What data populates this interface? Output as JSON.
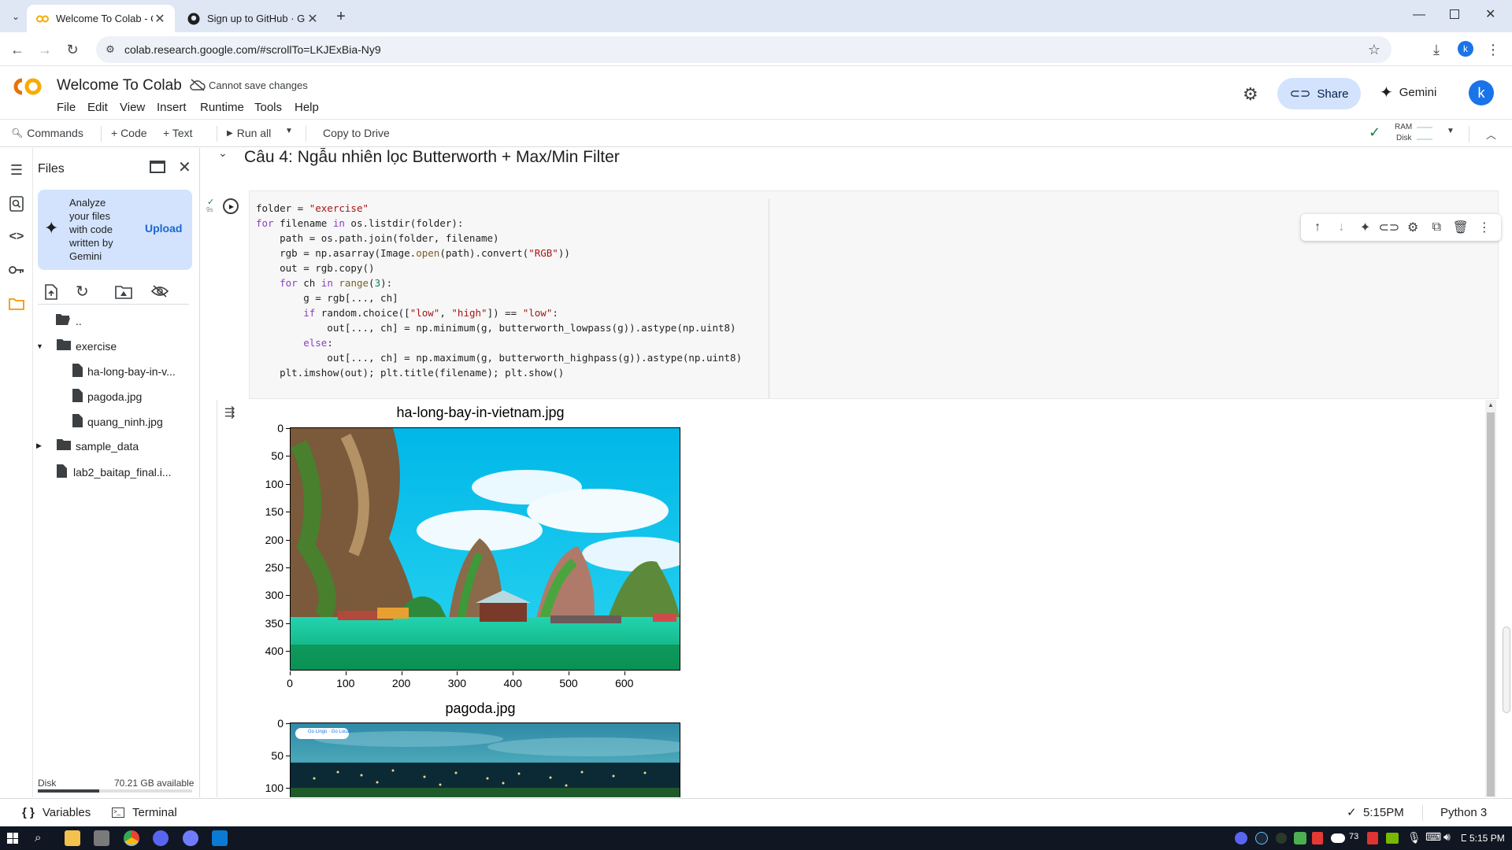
{
  "browser": {
    "tabs": [
      {
        "title": "Welcome To Colab - Colab",
        "active": true
      },
      {
        "title": "Sign up to GitHub · GitHub",
        "active": false
      }
    ],
    "url": "colab.research.google.com/#scrollTo=LKJExBia-Ny9",
    "profile_initial": "k"
  },
  "colab": {
    "notebook_title": "Welcome To Colab",
    "save_status": "Cannot save changes",
    "menu": [
      "File",
      "Edit",
      "View",
      "Insert",
      "Runtime",
      "Tools",
      "Help"
    ],
    "share_label": "Share",
    "gemini_label": "Gemini",
    "avatar_initial": "k",
    "toolbar": {
      "commands": "Commands",
      "code": "+ Code",
      "text": "+ Text",
      "run_all": "Run all",
      "copy_to_drive": "Copy to Drive",
      "ram": "RAM",
      "disk": "Disk"
    }
  },
  "files_panel": {
    "title": "Files",
    "promo_text": "Analyze your files with code written by Gemini",
    "upload_label": "Upload",
    "tree": [
      {
        "name": "..",
        "type": "folder"
      },
      {
        "name": "exercise",
        "type": "folder",
        "expanded": true
      },
      {
        "name": "ha-long-bay-in-v...",
        "type": "file"
      },
      {
        "name": "pagoda.jpg",
        "type": "file"
      },
      {
        "name": "quang_ninh.jpg",
        "type": "file"
      },
      {
        "name": "sample_data",
        "type": "folder"
      },
      {
        "name": "lab2_baitap_final.i...",
        "type": "file"
      }
    ],
    "disk_label": "Disk",
    "disk_available": "70.21 GB available",
    "disk_usage_fraction": 0.4
  },
  "notebook": {
    "section_heading": "Câu 4: Ngẫu nhiên lọc Butterworth + Max/Min Filter",
    "exec_time": "9s",
    "code": "folder = \"exercise\"\nfor filename in os.listdir(folder):\n    path = os.path.join(folder, filename)\n    rgb = np.asarray(Image.open(path).convert(\"RGB\"))\n    out = rgb.copy()\n    for ch in range(3):\n        g = rgb[..., ch]\n        if random.choice([\"low\", \"high\"]) == \"low\":\n            out[..., ch] = np.minimum(g, butterworth_lowpass(g)).astype(np.uint8)\n        else:\n            out[..., ch] = np.maximum(g, butterworth_highpass(g)).astype(np.uint8)\n    plt.imshow(out); plt.title(filename); plt.show()",
    "plots": [
      {
        "title": "ha-long-bay-in-vietnam.jpg",
        "y_ticks": [
          "0",
          "50",
          "100",
          "150",
          "200",
          "250",
          "300",
          "350",
          "400"
        ],
        "x_ticks": [
          "0",
          "100",
          "200",
          "300",
          "400",
          "500",
          "600"
        ]
      },
      {
        "title": "pagoda.jpg",
        "y_ticks": [
          "0",
          "50",
          "100"
        ],
        "image_caption": "Go Lingo · Go Local"
      }
    ]
  },
  "statusbar": {
    "variables": "Variables",
    "terminal": "Terminal",
    "time": "5:15PM",
    "kernel": "Python 3"
  },
  "taskbar": {
    "battery": "73",
    "clock": "5:15 PM"
  },
  "colors": {
    "chrome_tab_bg": "#dfe7f5",
    "share_bg": "#d3e3fd",
    "colab_orange": "#f9ab00",
    "link_blue": "#1967d2",
    "taskbar": "#101622"
  }
}
